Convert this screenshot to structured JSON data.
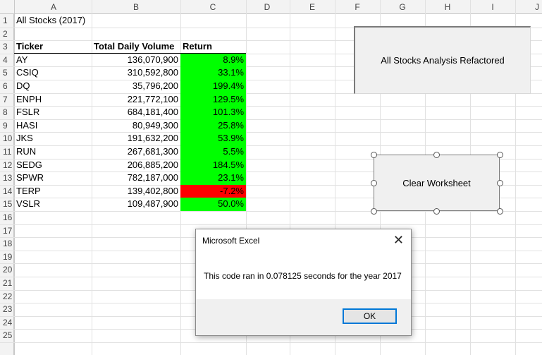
{
  "columns": [
    "A",
    "B",
    "C",
    "D",
    "E",
    "F",
    "G",
    "H",
    "I",
    "J"
  ],
  "rows": [
    "1",
    "2",
    "3",
    "4",
    "5",
    "6",
    "7",
    "8",
    "9",
    "10",
    "11",
    "12",
    "13",
    "14",
    "15",
    "16",
    "17",
    "18",
    "19",
    "20",
    "21",
    "22",
    "23",
    "24",
    "25"
  ],
  "sheet_title": "All Stocks (2017)",
  "table": {
    "headers": [
      "Ticker",
      "Total Daily Volume",
      "Return"
    ],
    "rows": [
      {
        "ticker": "AY",
        "volume": "136,070,900",
        "return": "8.9%",
        "positive": true
      },
      {
        "ticker": "CSIQ",
        "volume": "310,592,800",
        "return": "33.1%",
        "positive": true
      },
      {
        "ticker": "DQ",
        "volume": "35,796,200",
        "return": "199.4%",
        "positive": true
      },
      {
        "ticker": "ENPH",
        "volume": "221,772,100",
        "return": "129.5%",
        "positive": true
      },
      {
        "ticker": "FSLR",
        "volume": "684,181,400",
        "return": "101.3%",
        "positive": true
      },
      {
        "ticker": "HASI",
        "volume": "80,949,300",
        "return": "25.8%",
        "positive": true
      },
      {
        "ticker": "JKS",
        "volume": "191,632,200",
        "return": "53.9%",
        "positive": true
      },
      {
        "ticker": "RUN",
        "volume": "267,681,300",
        "return": "5.5%",
        "positive": true
      },
      {
        "ticker": "SEDG",
        "volume": "206,885,200",
        "return": "184.5%",
        "positive": true
      },
      {
        "ticker": "SPWR",
        "volume": "782,187,000",
        "return": "23.1%",
        "positive": true
      },
      {
        "ticker": "TERP",
        "volume": "139,402,800",
        "return": "-7.2%",
        "positive": false
      },
      {
        "ticker": "VSLR",
        "volume": "109,487,900",
        "return": "50.0%",
        "positive": true
      }
    ]
  },
  "buttons": {
    "analysis": "All Stocks Analysis Refactored",
    "clear": "Clear Worksheet"
  },
  "dialog": {
    "title": "Microsoft Excel",
    "message": "This code ran in 0.078125 seconds for the year 2017",
    "ok": "OK",
    "close_icon": "close-icon"
  },
  "colors": {
    "positive": "#00ff00",
    "negative": "#ff0000",
    "ok_border": "#0078d7"
  }
}
